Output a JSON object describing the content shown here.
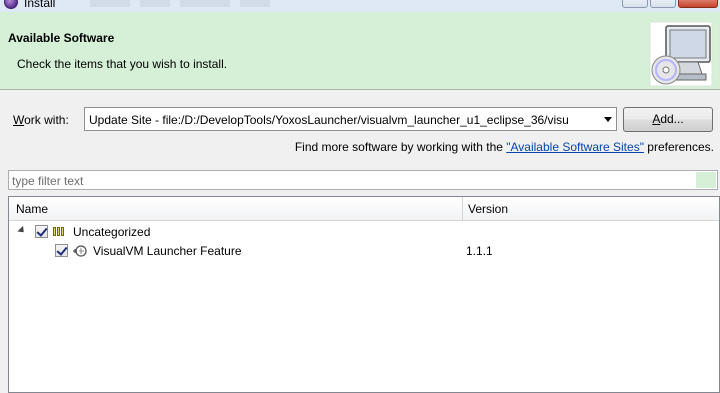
{
  "window": {
    "title": "Install"
  },
  "banner": {
    "heading": "Available Software",
    "description": "Check the items that you wish to install.",
    "icon": "monitor-cd-icon"
  },
  "work_with": {
    "label_prefix": "W",
    "label_rest": "ork with:",
    "value": "Update Site - file:/D:/DevelopTools/YoxosLauncher/visualvm_launcher_u1_eclipse_36/visu",
    "add_prefix": "A",
    "add_rest": "dd..."
  },
  "find_more": {
    "before": "Find more software by working with the ",
    "link": "\"Available Software Sites\"",
    "after": " preferences."
  },
  "filter": {
    "placeholder": "type filter text"
  },
  "table": {
    "columns": [
      "Name",
      "Version"
    ],
    "rows": [
      {
        "label": "Uncategorized",
        "version": "",
        "checked": true,
        "icon": "category-icon"
      },
      {
        "label": "VisualVM Launcher Feature",
        "version": "1.1.1",
        "checked": true,
        "icon": "feature-plug-icon"
      }
    ]
  },
  "colors": {
    "banner_bg": "#d6f0d8",
    "link": "#0645ad"
  }
}
